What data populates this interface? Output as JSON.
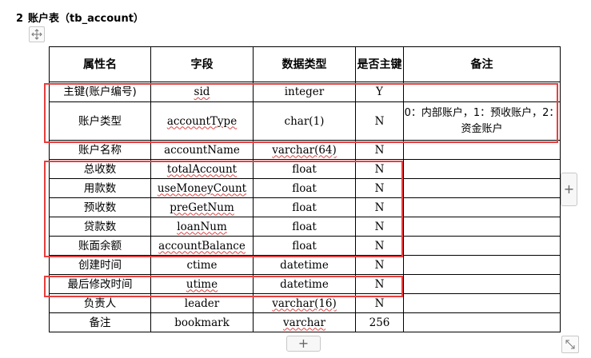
{
  "heading": {
    "number": "2",
    "title": "账户表（tb_account）"
  },
  "table": {
    "headers": [
      "属性名",
      "字段",
      "数据类型",
      "是否主键",
      "备注"
    ],
    "rows": [
      {
        "attr": "主键(账户编号)",
        "field": "sid",
        "type": "integer",
        "pk": "Y",
        "remark": ""
      },
      {
        "attr": "账户类型",
        "field": "accountType",
        "type": "char(1)",
        "pk": "N",
        "remark": "0：内部账户，1：预收账户，2：资金账户"
      },
      {
        "attr": "账户名称",
        "field": "accountName",
        "type": "varchar(64)",
        "pk": "N",
        "remark": ""
      },
      {
        "attr": "总收数",
        "field": "totalAccount",
        "type": "float",
        "pk": "N",
        "remark": ""
      },
      {
        "attr": "用款数",
        "field": "useMoneyCount",
        "type": "float",
        "pk": "N",
        "remark": ""
      },
      {
        "attr": "预收数",
        "field": "preGetNum",
        "type": "float",
        "pk": "N",
        "remark": ""
      },
      {
        "attr": "贷款数",
        "field": "loanNum",
        "type": "float",
        "pk": "N",
        "remark": ""
      },
      {
        "attr": "账面余额",
        "field": "accountBalance",
        "type": "float",
        "pk": "N",
        "remark": ""
      },
      {
        "attr": "创建时间",
        "field": "ctime",
        "type": "datetime",
        "pk": "N",
        "remark": ""
      },
      {
        "attr": "最后修改时间",
        "field": "utime",
        "type": "datetime",
        "pk": "N",
        "remark": ""
      },
      {
        "attr": "负责人",
        "field": "leader",
        "type": "varchar(16)",
        "pk": "N",
        "remark": ""
      },
      {
        "attr": "备注",
        "field": "bookmark",
        "type": "varchar",
        "pk": "256",
        "remark": ""
      }
    ]
  },
  "controls": {
    "add_column": "+",
    "add_row": "+"
  },
  "colors": {
    "highlight": "#e83e3e",
    "spellcheck": "#dd4444"
  },
  "icons": {
    "move": "move-arrows-icon",
    "resize": "resize-diagonal-icon"
  }
}
